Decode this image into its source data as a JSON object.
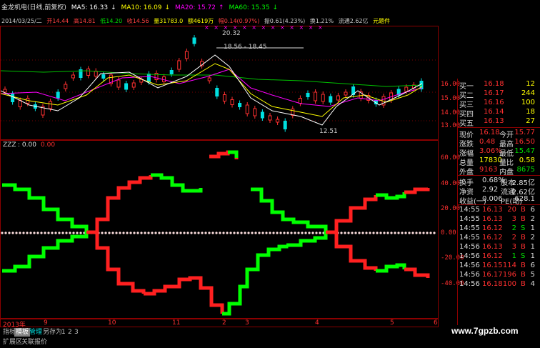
{
  "header": {
    "title": "金龙机电(日线,前复权)",
    "ma5": "MA5: 16.33",
    "ma10": "MA10: 16.09",
    "ma20": "MA20: 15.72",
    "ma60": "MA60: 15.35",
    "info": {
      "date": "2014/03/25/二",
      "open": "开14.44",
      "high": "高14.81",
      "low": "低14.20",
      "close": "收14.56",
      "volume": "量31783.0",
      "amount": "额4619万",
      "change": "幅0.14(0.97%)",
      "amplitude": "振0.61(4.23%)",
      "turnover": "换1.21%",
      "float": "流通2.62亿",
      "extra": "元题件"
    }
  },
  "price_chart": {
    "annotations": {
      "high": "20.32",
      "range": "18.56 - 18.45",
      "low": "12.51"
    },
    "y_ticks": [
      "16.00",
      "15.00",
      "14.00",
      "13.00"
    ]
  },
  "indicator": {
    "name": "ZZZ",
    "value": ": 0.00",
    "value2": "0.00",
    "y_ticks": [
      "60.00",
      "40.00",
      "20.00",
      "0.00",
      "-20.00",
      "-40.00"
    ]
  },
  "x_axis": {
    "labels": [
      "2013年",
      "9",
      "10",
      "11",
      "2",
      "3",
      "4",
      "5",
      "6"
    ]
  },
  "bottom_tabs": [
    "指标",
    "模板",
    "管理",
    "另存为",
    "1",
    "2",
    "3"
  ],
  "bottom_tabs2": [
    "扩展区",
    "关联报价"
  ],
  "watermark": "www.7gpzb.com",
  "order_book": [
    {
      "label": "买一",
      "price": "16.18",
      "vol": "12"
    },
    {
      "label": "买二",
      "price": "16.17",
      "vol": "244"
    },
    {
      "label": "买三",
      "price": "16.16",
      "vol": "100"
    },
    {
      "label": "买四",
      "price": "16.14",
      "vol": "18"
    },
    {
      "label": "买五",
      "price": "16.13",
      "vol": "27"
    }
  ],
  "stats": [
    {
      "l1": "现价",
      "v1": "16.18",
      "l2": "今开",
      "v2": "15.77",
      "c1": "#ff3030",
      "c2": "#ff3030"
    },
    {
      "l1": "涨跌",
      "v1": "0.48",
      "l2": "最高",
      "v2": "16.50",
      "c1": "#ff3030",
      "c2": "#ff3030"
    },
    {
      "l1": "涨幅",
      "v1": "3.06%",
      "l2": "最低",
      "v2": "15.47",
      "c1": "#ff3030",
      "c2": "#00e000"
    },
    {
      "l1": "总量",
      "v1": "17830",
      "l2": "量比",
      "v2": "0.58",
      "c1": "#ffff00",
      "c2": "#ffff00"
    },
    {
      "l1": "外盘",
      "v1": "9163",
      "l2": "内盘",
      "v2": "8675",
      "c1": "#ff3030",
      "c2": "#00e000"
    }
  ],
  "stats2": [
    {
      "l1": "换手",
      "v1": "0.68%",
      "l2": "股本",
      "v2": "2.85亿"
    },
    {
      "l1": "净资",
      "v1": "2.92",
      "l2": "流通",
      "v2": "2.62亿"
    },
    {
      "l1": "收益(一)",
      "v1": "0.006",
      "l2": "PE(动)",
      "v2": "628.1"
    }
  ],
  "ticks": [
    {
      "time": "14:55",
      "price": "16.13",
      "vol": "20",
      "side": "B",
      "n": "6"
    },
    {
      "time": "14:55",
      "price": "16.13",
      "vol": "3",
      "side": "B",
      "n": "2"
    },
    {
      "time": "14:55",
      "price": "16.12",
      "vol": "2",
      "side": "S",
      "n": "1"
    },
    {
      "time": "14:55",
      "price": "16.12",
      "vol": "2",
      "side": "B",
      "n": "2"
    },
    {
      "time": "14:56",
      "price": "16.13",
      "vol": "3",
      "side": "B",
      "n": "1"
    },
    {
      "time": "14:56",
      "price": "16.12",
      "vol": "1",
      "side": "S",
      "n": "1"
    },
    {
      "time": "14:56",
      "price": "16.15",
      "vol": "114",
      "side": "B",
      "n": "6"
    },
    {
      "time": "14:56",
      "price": "16.17",
      "vol": "196",
      "side": "B",
      "n": "5"
    },
    {
      "time": "14:56",
      "price": "16.18",
      "vol": "100",
      "side": "B",
      "n": "4"
    }
  ],
  "colors": {
    "up": "#ff0000",
    "down": "#00ff00",
    "border": "#8b0000"
  }
}
